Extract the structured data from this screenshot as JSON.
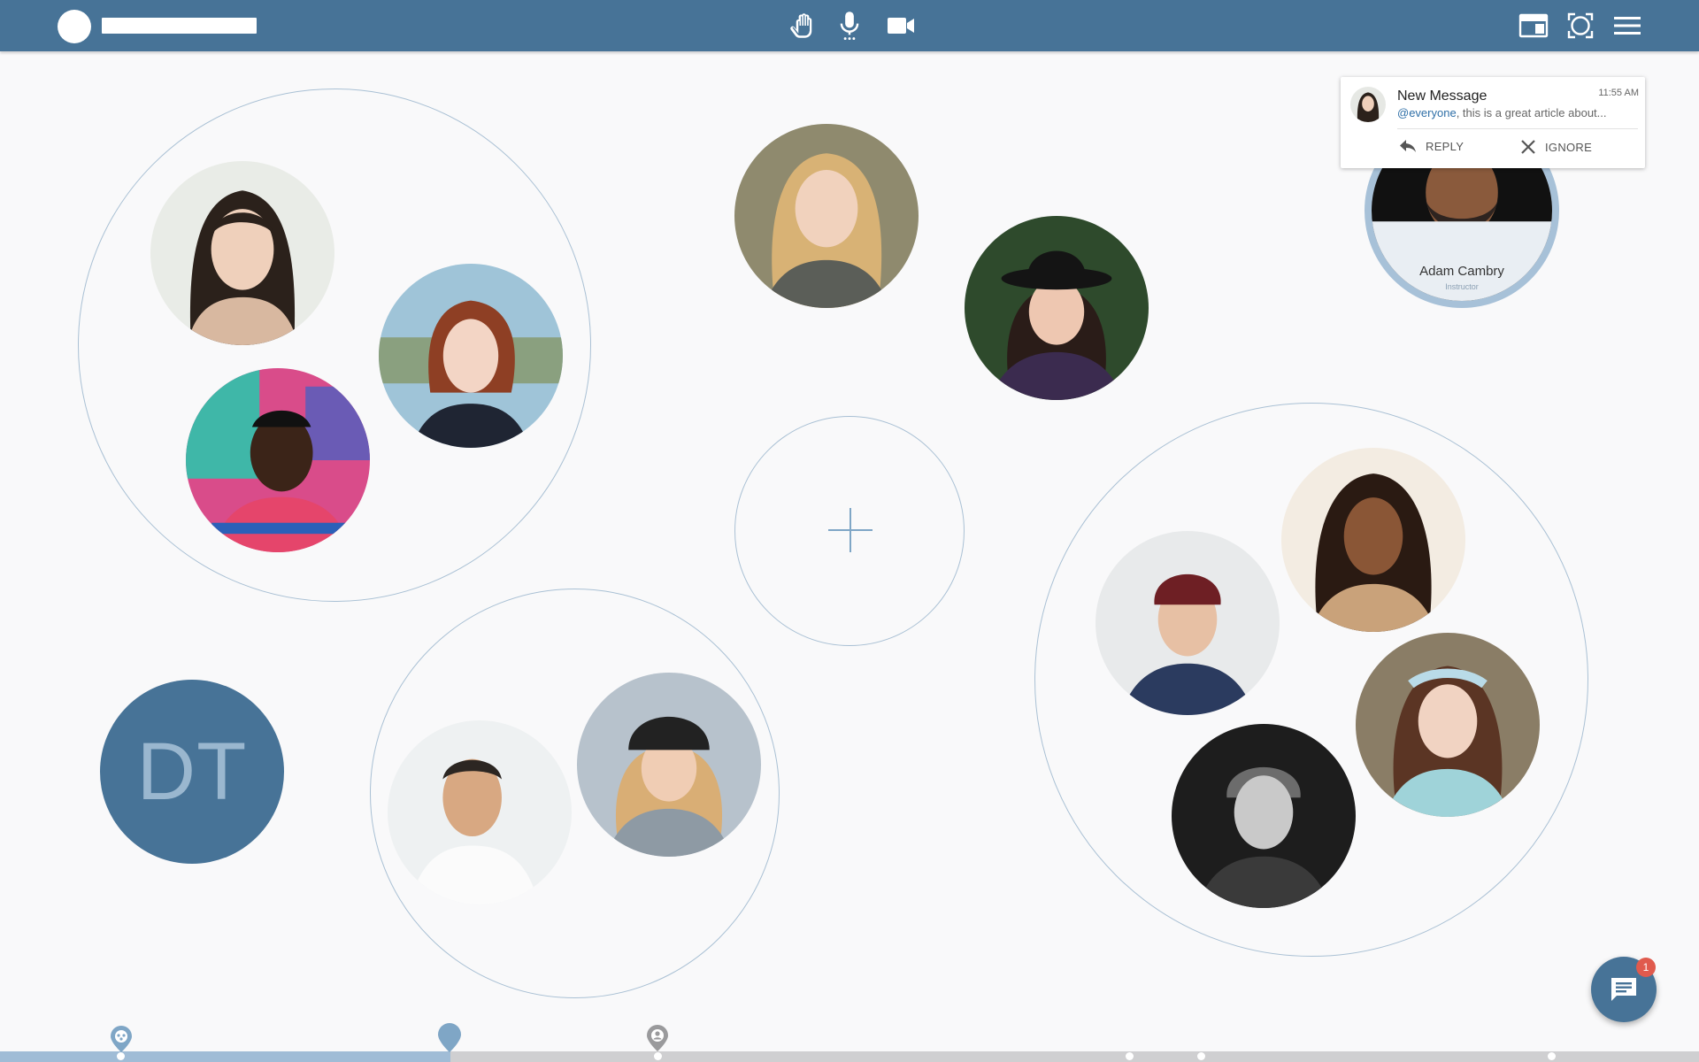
{
  "toolbar": {
    "icons": [
      "logo-circle",
      "hand-raise-icon",
      "microphone-icon",
      "video-camera-icon",
      "layout-icon",
      "screen-capture-icon",
      "menu-icon"
    ]
  },
  "instructor": {
    "name": "Adam Cambry",
    "role": "Instructor"
  },
  "notification": {
    "title": "New Message",
    "time": "11:55 AM",
    "mention": "@everyone",
    "text": ", this is a great article about...",
    "reply_label": "REPLY",
    "ignore_label": "IGNORE"
  },
  "user_avatar": {
    "initials": "DT"
  },
  "chat": {
    "unread_count": "1"
  },
  "timeline": {
    "progress": 0.265
  },
  "colors": {
    "brand": "#477397",
    "accent_light": "#a0bcd6",
    "badge": "#e05a4d"
  }
}
